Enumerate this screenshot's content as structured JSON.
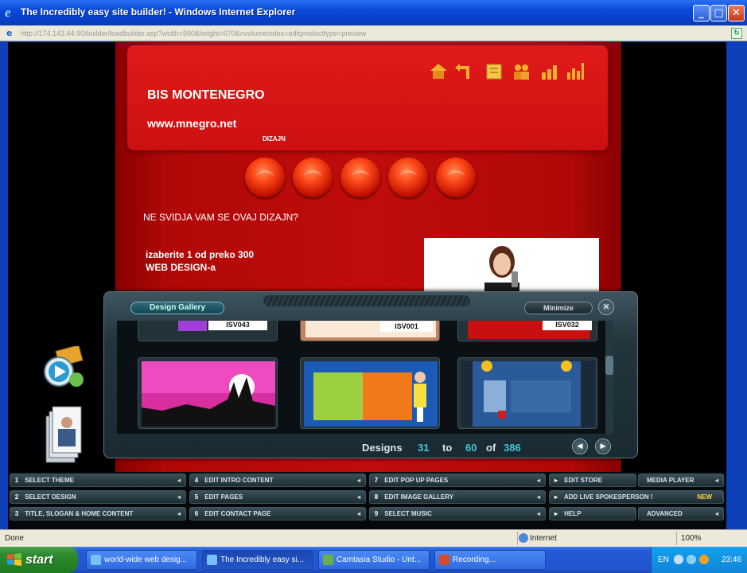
{
  "window": {
    "title": "The Incredibly easy site builder! - Windows Internet Explorer",
    "address_host": "http://174.143.44.90",
    "address_rest": "/builder/loadbuilder.asp?width=990&height=670&nvolumeindex=editproducttype=preview"
  },
  "site": {
    "brand": "BIS MONTENEGRO",
    "url": "www.mnegro.net",
    "subtitle": "DIZAJN",
    "question": "NE SVIDJA VAM SE OVAJ DIZAJN?",
    "choose_line1": "izaberite 1 od preko 300",
    "choose_line2": "WEB DESIGN-a"
  },
  "gallery": {
    "tab_label": "Design Gallery",
    "minimize_label": "Minimize",
    "close_glyph": "✕",
    "codes": [
      "ISV043",
      "ISV001",
      "ISV032"
    ],
    "footer": {
      "designs_label": "Designs",
      "from": "31",
      "to_label": "to",
      "to": "60",
      "of_label": "of",
      "total": "386",
      "accent_color": "#3fc7d6"
    },
    "prev_glyph": "◀",
    "next_glyph": "▶"
  },
  "menu": {
    "col1": [
      {
        "num": "1",
        "label": "SELECT THEME"
      },
      {
        "num": "2",
        "label": "SELECT DESIGN"
      },
      {
        "num": "3",
        "label": "TITLE, SLOGAN & HOME CONTENT"
      }
    ],
    "col2": [
      {
        "num": "4",
        "label": "EDIT INTRO CONTENT"
      },
      {
        "num": "5",
        "label": "EDIT PAGES"
      },
      {
        "num": "6",
        "label": "EDIT CONTACT PAGE"
      }
    ],
    "col3": [
      {
        "num": "7",
        "label": "EDIT POP UP PAGES"
      },
      {
        "num": "8",
        "label": "EDIT IMAGE GALLERY"
      },
      {
        "num": "9",
        "label": "SELECT MUSIC"
      }
    ],
    "col4": [
      {
        "label": "EDIT STORE"
      },
      {
        "label": "ADD LIVE SPOKESPERSON !"
      },
      {
        "label": "HELP"
      }
    ],
    "col5": [
      {
        "label": "MEDIA PLAYER"
      },
      {
        "label": "NEW"
      },
      {
        "label": "ADVANCED"
      }
    ],
    "arrow_glyph": "◂",
    "side_arrow_glyph": "▸"
  },
  "status": {
    "left": "Done",
    "zone": "Internet",
    "zoom": "100%"
  },
  "taskbar": {
    "start_label": "start",
    "tasks": [
      "world-wide web desig...",
      "The Incredibly easy si...",
      "Camtasia Studio - Unt...",
      "Recording..."
    ],
    "lang": "EN",
    "clock": "23:46"
  }
}
